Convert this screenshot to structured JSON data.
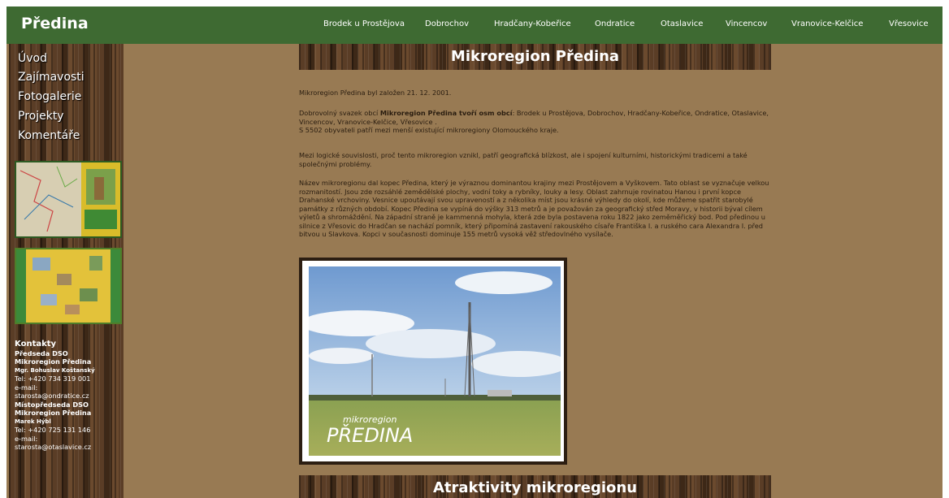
{
  "brand": "Předina",
  "nav": [
    "Brodek u Prostějova",
    "Dobrochov",
    "Hradčany-Kobeřice",
    "Ondratice",
    "Otaslavice",
    "Vincencov",
    "Vranovice-Kelčice",
    "Vřesovice"
  ],
  "menu": [
    "Úvod",
    "Zajímavosti",
    "Fotogalerie",
    "Projekty",
    "Komentáře"
  ],
  "contacts": {
    "title": "Kontakty",
    "l1": "Předseda DSO",
    "l2": "Mikroregion Předina",
    "l3": "Mgr. Bohuslav Koštanský",
    "l4": "Tel: +420 734 319 001",
    "l5": "e-mail:",
    "l6": "starosta@ondratice.cz",
    "l7": "Místopředseda DSO",
    "l8": "Mikroregion Předina",
    "l9": "Marek Hýbl",
    "l10": "Tel: +420 725 131 146",
    "l11": "e-mail:",
    "l12": "starosta@otaslavice.cz"
  },
  "main": {
    "title": "Mikroregion Předina",
    "p1": "Mikroregion Předina byl založen 21. 12. 2001.",
    "p2a": "Dobrovolný svazek obcí ",
    "p2b": "Mikroregion Předina tvoří osm obcí",
    "p2c": ": Brodek u Prostějova, Dobrochov, Hradčany-Kobeřice, Ondratice, Otaslavice, Vincencov, Vranovice-Kelčice, Vřesovice .",
    "p2d": "S 5502 obyvateli patří mezi menší existující mikroregiony Olomouckého kraje.",
    "p3": "Mezi logické souvislosti, proč tento mikroregion vznikl, patří geografická blízkost, ale i spojení kulturními, historickými tradicemi a také společnými problémy.",
    "p4": "Název mikroregionu dal kopec Předina, který je výraznou dominantou krajiny mezi Prostějovem a Vyškovem. Tato oblast se vyznačuje velkou rozmanitostí. Jsou zde rozsáhlé zemědělské plochy, vodní toky a rybníky, louky a lesy. Oblast zahrnuje rovinatou Hanou i první kopce Drahanské vrchoviny. Vesnice upoutávají svou upraveností a z několika míst jsou krásné výhledy do okolí, kde můžeme spatřit starobylé památky z různých období. Kopec Předina se vypíná do výšky 313 metrů a je považován za geografický střed Moravy, v historii býval cílem výletů a shromáždění. Na západní straně je kammenná mohyla, která zde byla postavena roku 1822 jako zeměměřický bod. Pod předinou u silnice z Vřesovic do Hradčan se nachází pomník, který připomíná zastavení rakouského císaře Františka I. a ruského cara Alexandra I. před bitvou u Slavkova. Kopci v současnosti dominuje 155 metrů vysoká věž středovlného vysílače.",
    "logo_small": "mikroregion",
    "logo_big": "PŘEDINA",
    "title2": "Atraktivity mikroregionu"
  }
}
